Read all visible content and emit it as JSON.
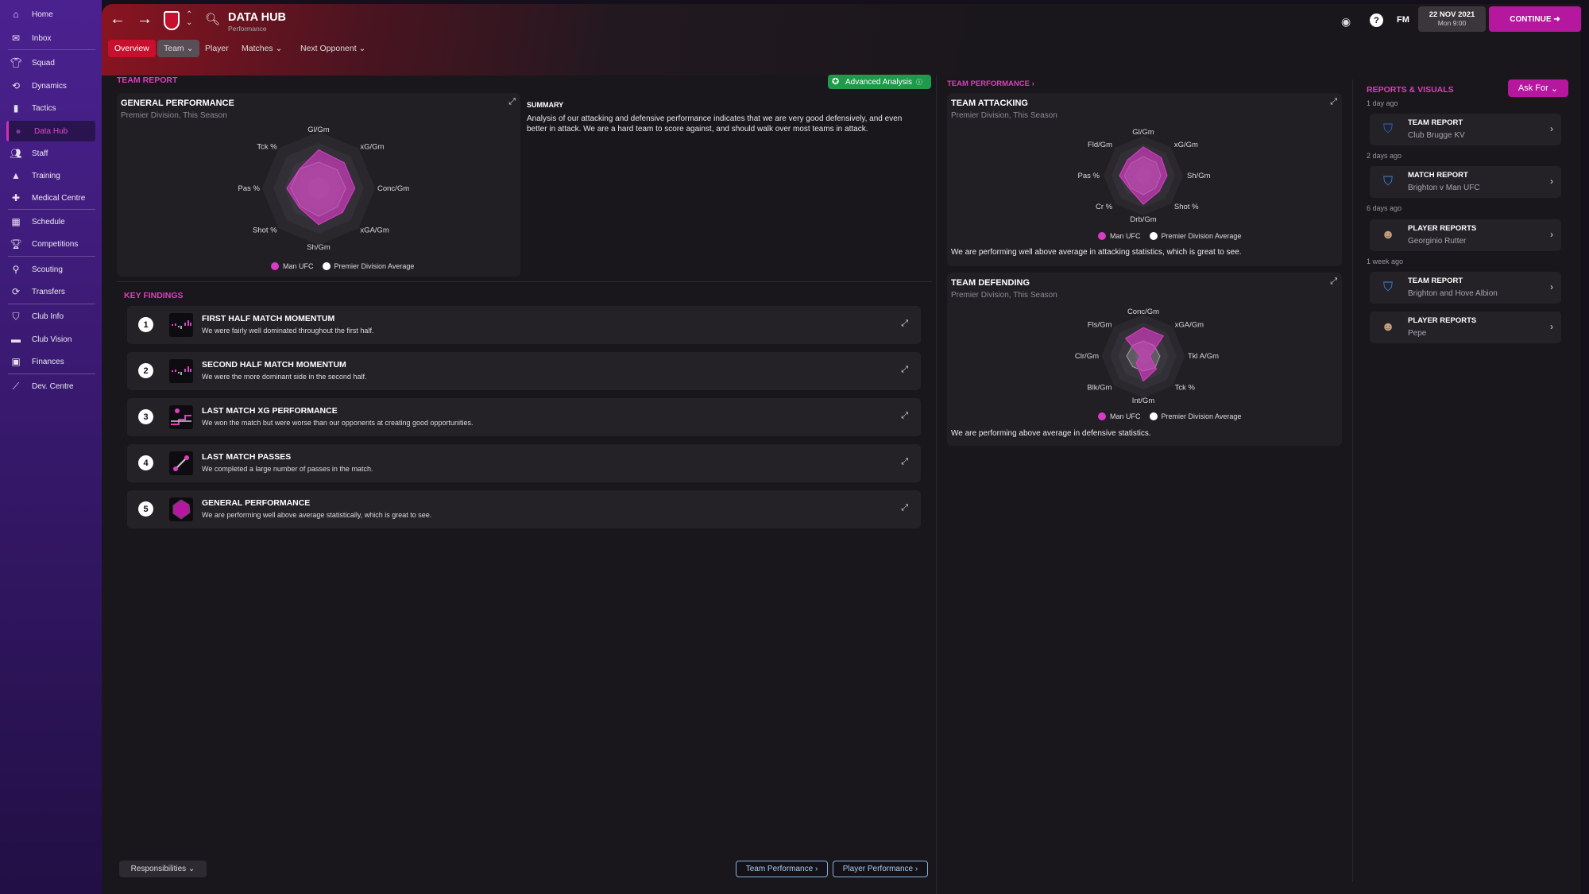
{
  "colors": {
    "accent": "#e03cbf",
    "continue": "#b5179e",
    "overview_tab": "#c8102e",
    "advanced": "#1f9a4a",
    "man_ufc": "#d63cc4",
    "average": "#ffffff"
  },
  "sidebar": {
    "items": [
      {
        "label": "Home",
        "icon": "home-icon"
      },
      {
        "label": "Inbox",
        "icon": "inbox-icon"
      },
      {
        "label": "Squad",
        "icon": "shirt-icon"
      },
      {
        "label": "Dynamics",
        "icon": "dynamics-icon"
      },
      {
        "label": "Tactics",
        "icon": "tactics-icon"
      },
      {
        "label": "Data Hub",
        "icon": "data-hub-icon",
        "active": true
      },
      {
        "label": "Staff",
        "icon": "staff-icon"
      },
      {
        "label": "Training",
        "icon": "training-icon"
      },
      {
        "label": "Medical Centre",
        "icon": "medical-icon"
      },
      {
        "label": "Schedule",
        "icon": "calendar-icon"
      },
      {
        "label": "Competitions",
        "icon": "trophy-icon"
      },
      {
        "label": "Scouting",
        "icon": "search-icon"
      },
      {
        "label": "Transfers",
        "icon": "transfer-icon"
      },
      {
        "label": "Club Info",
        "icon": "shield-icon"
      },
      {
        "label": "Club Vision",
        "icon": "briefcase-icon"
      },
      {
        "label": "Finances",
        "icon": "money-icon"
      },
      {
        "label": "Dev. Centre",
        "icon": "chart-line-icon"
      }
    ]
  },
  "header": {
    "title": "DATA HUB",
    "subtitle": "Performance",
    "fm": "FM",
    "date": "22 NOV 2021",
    "time": "Mon 9:00",
    "continue": "CONTINUE"
  },
  "tabs": [
    {
      "label": "Overview"
    },
    {
      "label": "Team ⌄"
    },
    {
      "label": "Player"
    },
    {
      "label": "Matches ⌄"
    },
    {
      "label": "Next Opponent ⌄"
    }
  ],
  "team_report": {
    "label": "TEAM REPORT",
    "advanced": "Advanced Analysis",
    "general": {
      "title": "GENERAL PERFORMANCE",
      "sub": "Premier Division, This Season",
      "axes": [
        "Gl/Gm",
        "xG/Gm",
        "Conc/Gm",
        "xGA/Gm",
        "Sh/Gm",
        "Shot %",
        "Pas %",
        "Tck %"
      ],
      "team": [
        0.85,
        0.8,
        0.8,
        0.75,
        0.8,
        0.6,
        0.7,
        0.6
      ],
      "avg": [
        0.58,
        0.58,
        0.6,
        0.58,
        0.62,
        0.56,
        0.62,
        0.6
      ]
    },
    "summary_title": "SUMMARY",
    "summary": "Analysis of our attacking and defensive performance indicates that we are very good defensively, and even better in attack. We are a hard team to score against, and should walk over most teams in attack."
  },
  "legend": {
    "team": "Man UFC",
    "avg": "Premier Division Average"
  },
  "key_findings": {
    "label": "KEY FINDINGS",
    "items": [
      {
        "n": "1",
        "title": "FIRST HALF MATCH MOMENTUM",
        "desc": "We were fairly well dominated throughout the first half.",
        "icon": "momentum-icon"
      },
      {
        "n": "2",
        "title": "SECOND HALF MATCH MOMENTUM",
        "desc": "We were the more dominant side in the second half.",
        "icon": "momentum-icon"
      },
      {
        "n": "3",
        "title": "LAST MATCH XG PERFORMANCE",
        "desc": "We won the match but were worse than our opponents at creating good opportunities.",
        "icon": "xg-icon"
      },
      {
        "n": "4",
        "title": "LAST MATCH PASSES",
        "desc": "We completed a large number of passes in the match.",
        "icon": "passes-icon"
      },
      {
        "n": "5",
        "title": "GENERAL PERFORMANCE",
        "desc": "We are performing well above average statistically, which is great to see.",
        "icon": "radar-icon"
      }
    ]
  },
  "team_performance": {
    "label": "TEAM PERFORMANCE ›",
    "attacking": {
      "title": "TEAM ATTACKING",
      "sub": "Premier Division, This Season",
      "axes": [
        "Gl/Gm",
        "xG/Gm",
        "Sh/Gm",
        "Shot %",
        "Drb/Gm",
        "Cr %",
        "Pas %",
        "Fld/Gm"
      ],
      "team": [
        0.9,
        0.8,
        0.75,
        0.7,
        0.9,
        0.6,
        0.75,
        0.7
      ],
      "avg": [
        0.6,
        0.58,
        0.55,
        0.55,
        0.6,
        0.55,
        0.6,
        0.55
      ],
      "text": "We are performing well above average in attacking statistics, which is great to see."
    },
    "defending": {
      "title": "TEAM DEFENDING",
      "sub": "Premier Division, This Season",
      "axes": [
        "Conc/Gm",
        "xGA/Gm",
        "Tkl A/Gm",
        "Tck %",
        "Int/Gm",
        "Blk/Gm",
        "Clr/Gm",
        "Fls/Gm"
      ],
      "team": [
        0.85,
        0.85,
        0.2,
        0.55,
        0.75,
        0.3,
        0.1,
        0.75
      ],
      "avg": [
        0.45,
        0.45,
        0.5,
        0.5,
        0.45,
        0.45,
        0.5,
        0.45
      ],
      "text": "We are performing above average in defensive statistics."
    }
  },
  "reports": {
    "label": "REPORTS & VISUALS",
    "ask": "Ask For",
    "groups": [
      {
        "time": "1 day ago"
      },
      {
        "time": "2 days ago"
      },
      {
        "time": "6 days ago"
      },
      {
        "time": "1 week ago"
      }
    ],
    "items": [
      {
        "title": "TEAM REPORT",
        "sub": "Club Brugge KV",
        "icon": "club-brugge-crest-icon"
      },
      {
        "title": "MATCH REPORT",
        "sub": "Brighton v Man UFC",
        "icon": "brighton-crest-icon"
      },
      {
        "title": "PLAYER REPORTS",
        "sub": "Georginio Rutter",
        "icon": "player-portrait-icon"
      },
      {
        "title": "TEAM REPORT",
        "sub": "Brighton and Hove Albion",
        "icon": "brighton-crest-icon"
      },
      {
        "title": "PLAYER REPORTS",
        "sub": "Pepe",
        "icon": "player-portrait-icon"
      }
    ]
  },
  "footer": {
    "responsibilities": "Responsibilities ⌄",
    "team_perf": "Team Performance ›",
    "player_perf": "Player Performance ›"
  }
}
